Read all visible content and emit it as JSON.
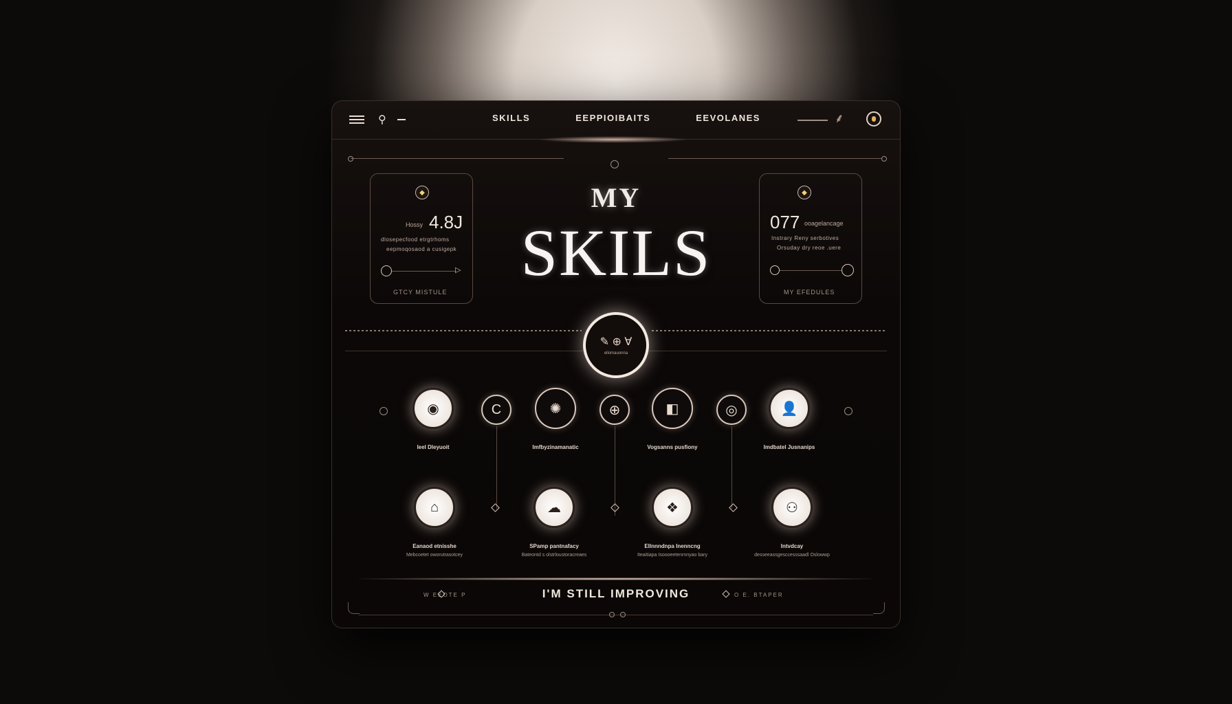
{
  "nav": {
    "tabs": [
      "SKILLS",
      "EEPPIOIBAITS",
      "EEVOLANES"
    ]
  },
  "hero": {
    "my": "MY",
    "skills": "SKILS"
  },
  "left_stat": {
    "label": "Hossy",
    "value": "4.8J",
    "line1": "dlosepecfood etrgtrhoms",
    "line2": "eepmoqosaod a cusigepk",
    "link": "GTCY MISTULE"
  },
  "right_stat": {
    "value": "077",
    "label": "ooagelancage",
    "line1": "Instrary Reny serbotives",
    "line2": "Orsuday dry reoe .uere",
    "link": "MY EFEDULES"
  },
  "center_button": {
    "icon": "✎ ⊕ Ɐ",
    "text": "ellomauonna"
  },
  "skills_row1": [
    {
      "label": "Ieel Dleyuoit",
      "icon": "eye-icon",
      "glyph": "◉"
    },
    {
      "label": "",
      "icon": "c-icon",
      "glyph": "C"
    },
    {
      "label": "Imfbyzinamanatic",
      "icon": "aperture-icon",
      "glyph": "✺"
    },
    {
      "label": "",
      "icon": "globe-icon",
      "glyph": "⊕"
    },
    {
      "label": "Vogsanns pusfiony",
      "icon": "cube-icon",
      "glyph": "◧"
    },
    {
      "label": "",
      "icon": "lens-icon",
      "glyph": "◎"
    },
    {
      "label": "Imdbatel Jusnanips",
      "icon": "user-icon",
      "glyph": "👤"
    }
  ],
  "skills_row2": [
    {
      "label": "Eanaod etnisshe",
      "sub": "Mebcoetet oworutrasotcey",
      "icon": "lock-icon",
      "glyph": "⌂"
    },
    {
      "label": "SPamp pantnafacy",
      "sub": "Bateontd s olstrloustoracreaes",
      "icon": "cloud-icon",
      "glyph": "☁"
    },
    {
      "label": "Ellnnndnpa Inenncng",
      "sub": "Iteaitiapa Isoooeetenrnnyao bary",
      "icon": "diamond-grid-icon",
      "glyph": "❖"
    },
    {
      "label": "Intvdcay",
      "sub": "desseeassgesccesssaadl Oslowwp",
      "icon": "share-icon",
      "glyph": "⚇"
    }
  ],
  "footer": {
    "text": "I'M STILL IMPROVING",
    "left": "W EEOTE P",
    "right": "O E. BTAPER"
  },
  "colors": {
    "background": "#0a0706",
    "accent": "#f3e9e1",
    "gold": "#e6b35f"
  }
}
